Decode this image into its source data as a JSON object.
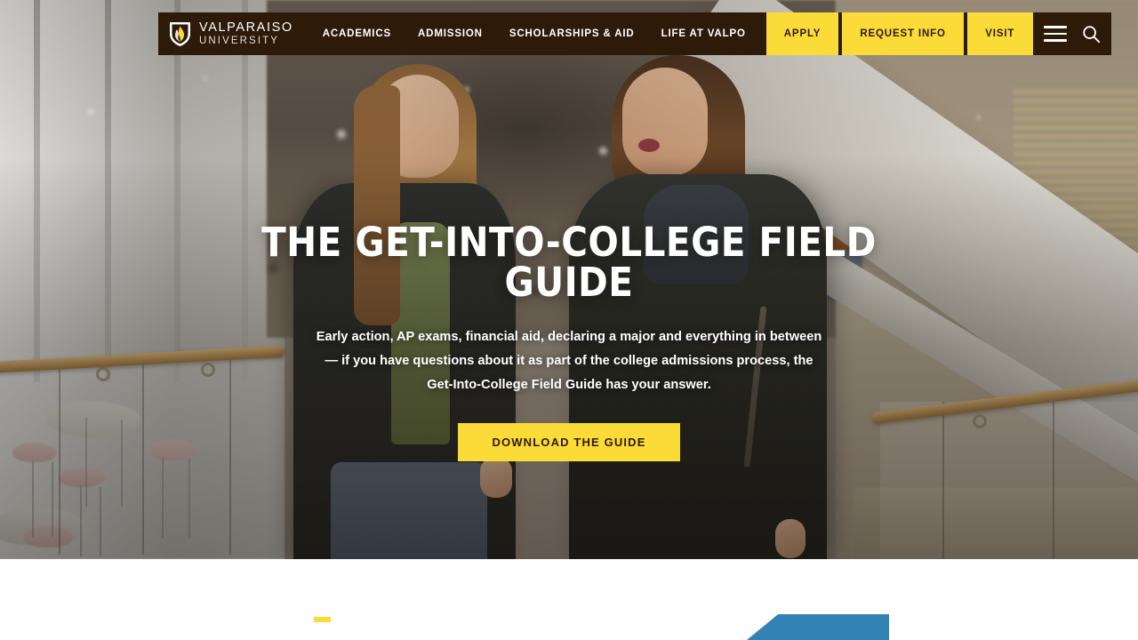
{
  "site": {
    "brand_line1": "VALPARAISO",
    "brand_line2": "UNIVERSITY",
    "logo_icon": "shield-flame-logo-icon",
    "colors": {
      "brand_brown": "#2e1a08",
      "brand_yellow": "#fbdb38",
      "accent_blue": "#3282b6",
      "text_white": "#ffffff"
    }
  },
  "nav": {
    "items": [
      {
        "label": "ACADEMICS"
      },
      {
        "label": "ADMISSION"
      },
      {
        "label": "SCHOLARSHIPS & AID"
      },
      {
        "label": "LIFE AT VALPO"
      }
    ],
    "ctas": [
      {
        "label": "APPLY"
      },
      {
        "label": "REQUEST INFO"
      },
      {
        "label": "VISIT"
      }
    ],
    "menu_icon": "hamburger-menu-icon",
    "search_icon": "search-icon"
  },
  "hero": {
    "title": "THE GET-INTO-COLLEGE FIELD GUIDE",
    "subtitle": "Early action, AP exams, financial aid, declaring a major and everything in between — if you have questions about it as part of the college admissions process, the Get-Into-College Field Guide has your answer.",
    "button_label": "DOWNLOAD THE GUIDE",
    "background_image_alt": "Two students talking on a glass-railed walkway inside a bright campus building"
  },
  "below_fold": {
    "divider_accent": "yellow-rule",
    "shape_accent": "blue-angled-shape"
  }
}
